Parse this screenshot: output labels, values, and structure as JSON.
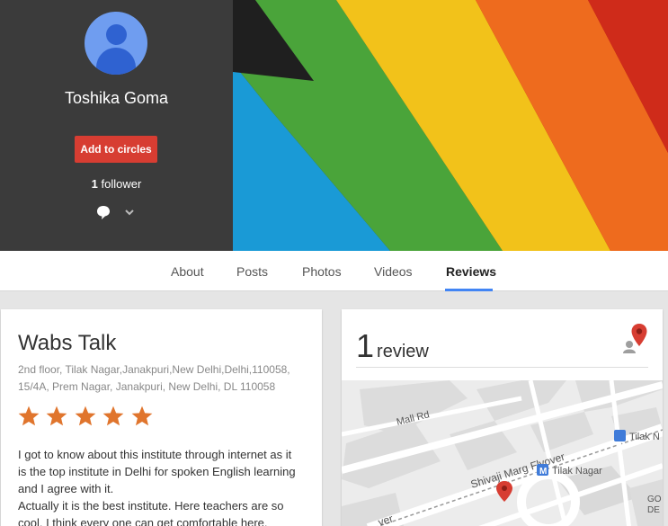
{
  "profile": {
    "name": "Toshika Goma",
    "add_button": "Add to circles",
    "follower_count": "1",
    "follower_label": "follower",
    "avatar_icon": "person-icon"
  },
  "tabs": [
    {
      "label": "About"
    },
    {
      "label": "Posts"
    },
    {
      "label": "Photos"
    },
    {
      "label": "Videos"
    },
    {
      "label": "Reviews",
      "active": true
    }
  ],
  "review": {
    "business": "Wabs Talk",
    "address_line1": "2nd floor, Tilak Nagar,Janakpuri,New Delhi,Delhi,110058,",
    "address_line2": "15/4A, Prem Nagar, Janakpuri, New Delhi, DL 110058",
    "rating": 5,
    "text_line1": "I got to know about this institute through internet as it",
    "text_line2": "is the top institute in Delhi for spoken English learning",
    "text_line3": "and I agree with it.",
    "text_line4": "Actually it is the best institute. Here teachers are so",
    "text_line5": "cool. I think every one can get comfortable here."
  },
  "summary": {
    "count": "1",
    "label": "review"
  },
  "map": {
    "labels": {
      "mall_rd": "Mall Rd",
      "flyover": "Shivaji Marg Flyover",
      "tilak_nagar": "Tilak Nagar",
      "tilak_right": "Tilak N",
      "go": "GO",
      "de": "DE",
      "over": "ver"
    }
  },
  "colors": {
    "accent_red": "#d73d32",
    "tab_underline": "#4285f4",
    "star": "#e0752d",
    "profile_bg": "#3b3b3b"
  }
}
